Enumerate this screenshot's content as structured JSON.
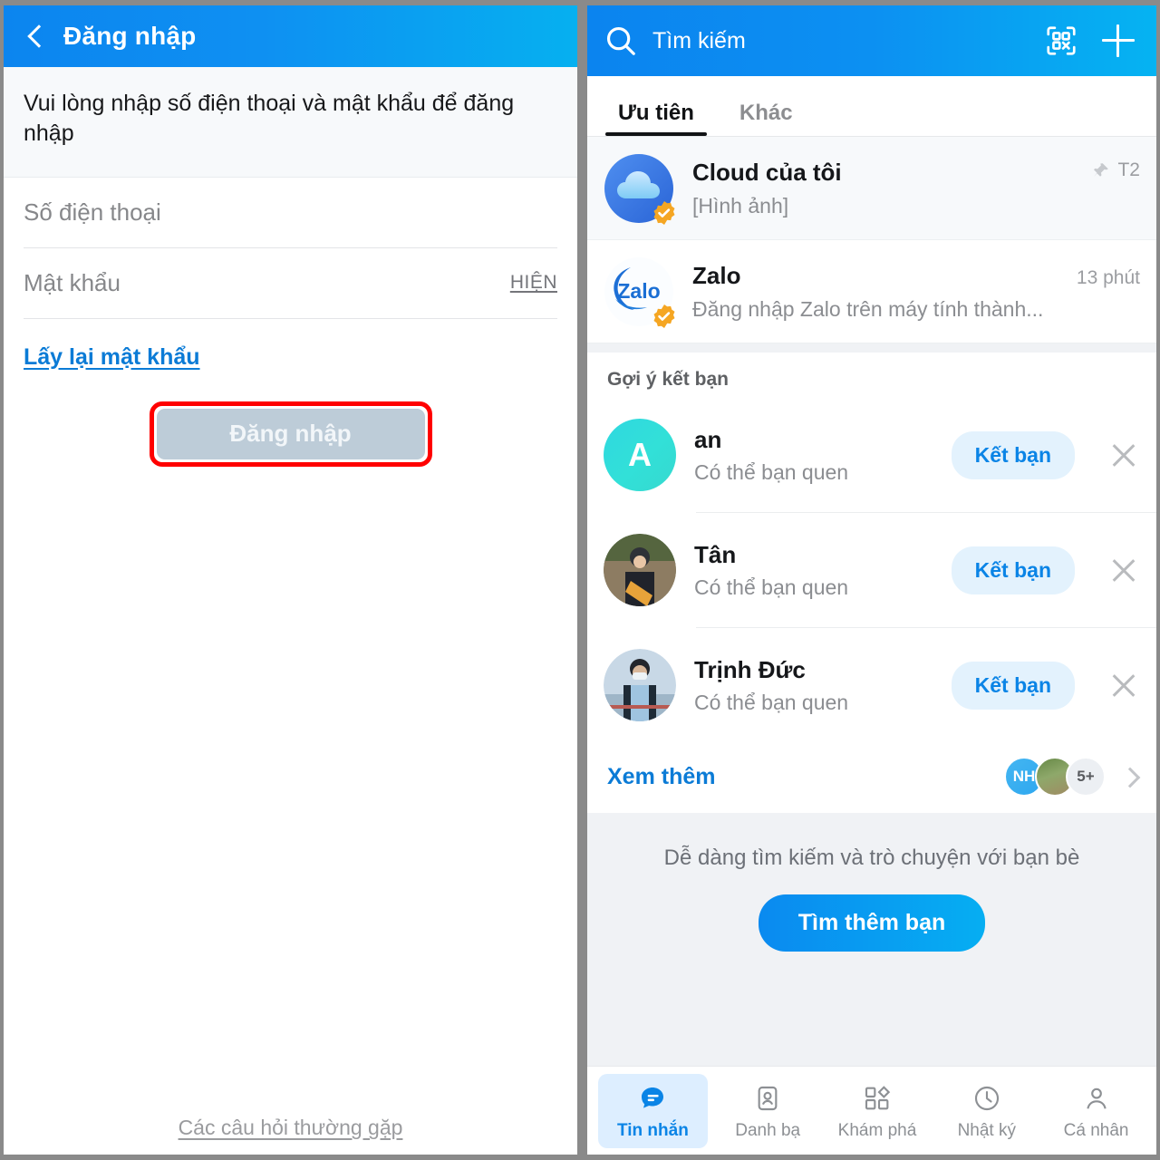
{
  "login_screen": {
    "appbar": {
      "back_icon": "back-chevron-icon",
      "title": "Đăng nhập"
    },
    "instruction": "Vui lòng nhập số điện thoại và mật khẩu để đăng nhập",
    "fields": [
      {
        "label": "Số điện thoại",
        "value": "",
        "placeholder": "Số điện thoại",
        "action": ""
      },
      {
        "label": "Mật khẩu",
        "value": "",
        "placeholder": "Mật khẩu",
        "action": "HIỆN"
      }
    ],
    "forgot_password": "Lấy lại mật khẩu",
    "submit_label": "Đăng nhập",
    "submit_highlight_color": "#ff0000",
    "submit_bg_color": "#bdccd8",
    "faq_link": "Các câu hỏi thường gặp"
  },
  "messages_screen": {
    "appbar": {
      "search_icon": "search-icon",
      "search_placeholder": "Tìm kiếm",
      "qr_icon": "qr-code-icon",
      "add_icon": "plus-icon",
      "accent": "#0b84ef"
    },
    "tabs": [
      {
        "label": "Ưu tiên",
        "active": true
      },
      {
        "label": "Khác",
        "active": false
      }
    ],
    "chats": [
      {
        "avatar": "cloud-icon",
        "name": "Cloud của tôi",
        "preview": "[Hình ảnh]",
        "time": "T2",
        "pinned": true,
        "pin_icon": "pin-icon",
        "verified": true
      },
      {
        "avatar": "zalo-logo",
        "name": "Zalo",
        "preview": "Đăng nhập Zalo trên máy tính thành...",
        "time": "13 phút",
        "pinned": false,
        "verified": true
      }
    ],
    "suggestions": {
      "title": "Gợi ý kết bạn",
      "items": [
        {
          "name": "an",
          "subtitle": "Có thể bạn quen",
          "avatar_type": "initial",
          "initial": "A",
          "add_label": "Kết bạn",
          "close_icon": "close-icon"
        },
        {
          "name": "Tân",
          "subtitle": "Có thể bạn quen",
          "avatar_type": "photo",
          "initial": "",
          "add_label": "Kết bạn",
          "close_icon": "close-icon"
        },
        {
          "name": "Trịnh Đức",
          "subtitle": "Có thể bạn quen",
          "avatar_type": "photo",
          "initial": "",
          "add_label": "Kết bạn",
          "close_icon": "close-icon"
        }
      ],
      "see_more": "Xem thêm",
      "avatar_group": [
        {
          "type": "initial",
          "label": "NH"
        },
        {
          "type": "photo",
          "label": ""
        },
        {
          "type": "count",
          "label": "5+"
        }
      ],
      "chevron_icon": "chevron-right-icon"
    },
    "promo": {
      "text": "Dễ dàng tìm kiếm và trò chuyện với bạn bè",
      "button_label": "Tìm thêm bạn",
      "button_color": "#0a8af0"
    },
    "bottom_nav": [
      {
        "label": "Tin nhắn",
        "icon": "chat-bubble-icon",
        "active": true
      },
      {
        "label": "Danh bạ",
        "icon": "contacts-icon",
        "active": false
      },
      {
        "label": "Khám phá",
        "icon": "discover-grid-icon",
        "active": false
      },
      {
        "label": "Nhật ký",
        "icon": "clock-icon",
        "active": false
      },
      {
        "label": "Cá nhân",
        "icon": "person-icon",
        "active": false
      }
    ]
  }
}
